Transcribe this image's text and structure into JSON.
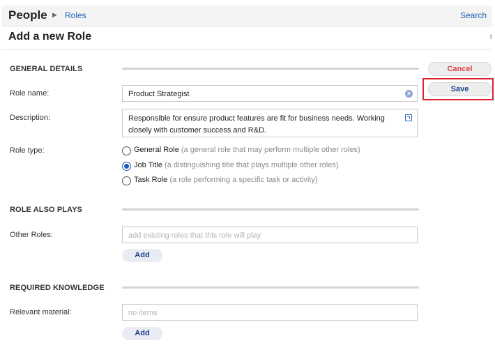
{
  "breadcrumb": {
    "root": "People",
    "current": "Roles"
  },
  "header": {
    "search_label": "Search",
    "page_title": "Add a new Role"
  },
  "actions": {
    "cancel_label": "Cancel",
    "save_label": "Save"
  },
  "general": {
    "section_title": "GENERAL DETAILS",
    "role_name_label": "Role name:",
    "role_name_value": "Product Strategist",
    "description_label": "Description:",
    "description_value": "Responsible for ensure product features are fit for business needs. Working closely with customer success and R&D.",
    "role_type_label": "Role type:",
    "role_types": [
      {
        "name": "General Role",
        "hint": "(a general role that may perform multiple other roles)",
        "selected": false
      },
      {
        "name": "Job Title",
        "hint": "(a distinguishing title that plays multiple other roles)",
        "selected": true
      },
      {
        "name": "Task Role",
        "hint": "(a role performing a specific task or activity)",
        "selected": false
      }
    ]
  },
  "also_plays": {
    "section_title": "ROLE ALSO PLAYS",
    "other_roles_label": "Other Roles:",
    "other_roles_placeholder": "add existing roles that this role will play",
    "add_label": "Add"
  },
  "knowledge": {
    "section_title": "REQUIRED KNOWLEDGE",
    "material_label": "Relevant material:",
    "material_placeholder": "no items",
    "add_label": "Add"
  },
  "colors": {
    "accent": "#1f5bb5",
    "cancel": "#d94848",
    "highlight": "#e0202a"
  }
}
